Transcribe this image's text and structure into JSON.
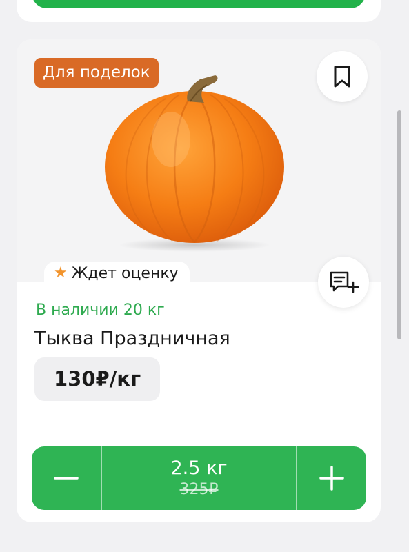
{
  "product": {
    "tag": "Для поделок",
    "rating_status": "Ждет оценку",
    "stock": "В наличии 20 кг",
    "name": "Тыква Праздничная",
    "price": "130₽/кг"
  },
  "quantity": {
    "value": "2.5 кг",
    "old_price": "325₽"
  },
  "icons": {
    "bookmark": "bookmark-icon",
    "review": "review-add-icon",
    "star": "star-icon",
    "minus": "minus-icon",
    "plus": "plus-icon"
  },
  "colors": {
    "accent_green": "#2fb454",
    "stock_green": "#2eaa4f",
    "tag_orange": "#d96a26",
    "star_orange": "#f2942d"
  }
}
